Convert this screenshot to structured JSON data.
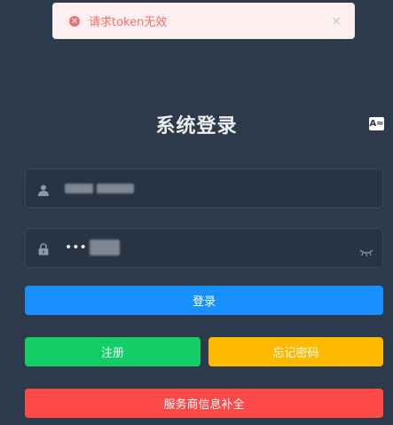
{
  "toast": {
    "message": "请求token无效",
    "close": "×",
    "icon_glyph": "×"
  },
  "title": "系统登录",
  "lang_switch": "A≈",
  "username": {
    "value": ""
  },
  "password": {
    "dots": "•••"
  },
  "buttons": {
    "login": "登录",
    "register": "注册",
    "forgot": "忘记密码",
    "supplement": "服务商信息补全"
  },
  "colors": {
    "background": "#2d3a4b",
    "login": "#1890ff",
    "register": "#13ce66",
    "forgot": "#ffba00",
    "supplement": "#ff4949",
    "toast_text": "#f56c6c"
  },
  "icons": [
    "error-icon",
    "close-icon",
    "user-icon",
    "lock-icon",
    "eye-closed-icon",
    "translate-icon"
  ]
}
